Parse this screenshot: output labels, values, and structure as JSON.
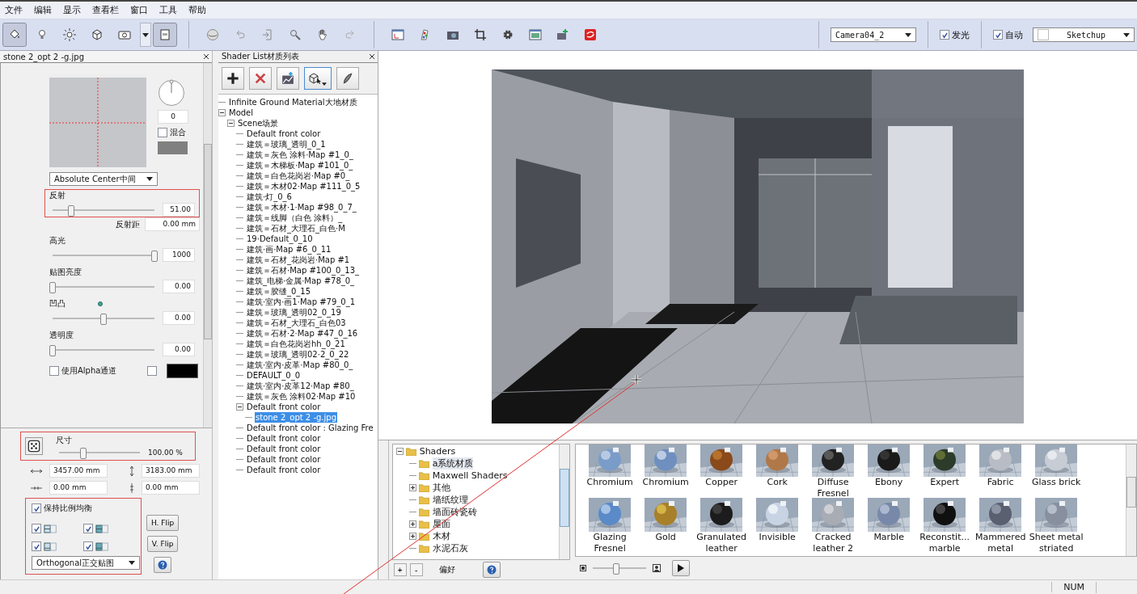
{
  "menu": [
    "文件",
    "编辑",
    "显示",
    "查看栏",
    "窗口",
    "工具",
    "帮助"
  ],
  "toolbar": {
    "mode_tools": [
      {
        "selected": true
      },
      {
        "selected": false
      },
      {
        "selected": false
      },
      {
        "selected": false
      },
      {
        "selected": false
      },
      {
        "selected": true
      }
    ],
    "camera": "Camera04_2",
    "glow": {
      "label": "发光",
      "checked": true
    },
    "auto": {
      "label": "自动",
      "checked": true
    },
    "renderer": "Sketchup"
  },
  "texture_panel": {
    "title": "stone 2_opt 2 -g.jpg",
    "rotation": "0",
    "blend": {
      "label": "混合",
      "checked": false
    },
    "projection": "Absolute Center中间",
    "sliders": [
      {
        "label": "反射",
        "level": 0.18,
        "value": "51.00",
        "highlighted": true
      },
      {
        "label": "高光",
        "level": 1.0,
        "value": "1000",
        "highlighted": false
      },
      {
        "label": "贴图亮度",
        "level": 0.0,
        "value": "0.00",
        "highlighted": false
      },
      {
        "label": "凹凸",
        "level": 0.5,
        "value": "0.00",
        "highlighted": false
      },
      {
        "label": "透明度",
        "level": 0.0,
        "value": "0.00",
        "highlighted": false
      }
    ],
    "reflect_distance": {
      "label": "反射距",
      "value": "0.00 mm"
    },
    "alpha": {
      "label": "使用Alpha通道",
      "checked": false,
      "invert_checked": false
    },
    "size": {
      "label": "尺寸",
      "level": 0.3,
      "value": "100.00 %",
      "highlighted": true
    },
    "width": "3457.00 mm",
    "height": "3183.00 mm",
    "offset_x": "0.00 mm",
    "offset_y": "0.00 mm",
    "keep_ratio": {
      "label": "保持比例均衡",
      "checked": true
    },
    "options_highlighted": true,
    "tiling": [
      {
        "checked": true
      },
      {
        "checked": true
      },
      {
        "checked": true
      },
      {
        "checked": true
      }
    ],
    "h_flip": "H. Flip",
    "v_flip": "V. Flip",
    "mapping": "Orthogonal正交贴图"
  },
  "shader_list": {
    "title": "Shader List材质列表",
    "tree": [
      {
        "label": "Infinite Ground Material大地材质",
        "selected": false
      },
      {
        "label": "Model",
        "expanded": true,
        "selected": false,
        "children": [
          {
            "label": "Scene场景",
            "expanded": true,
            "selected": false,
            "children": [
              {
                "label": "Default front color",
                "selected": false
              },
              {
                "label": "建筑＝玻璃_透明_0_1",
                "selected": false
              },
              {
                "label": "建筑＝灰色 涂料·Map #1_0_",
                "selected": false
              },
              {
                "label": "建筑＝木梯板·Map #101_0_",
                "selected": false
              },
              {
                "label": "建筑＝白色花岗岩·Map #0_",
                "selected": false
              },
              {
                "label": "建筑＝木材02·Map #111_0_5",
                "selected": false
              },
              {
                "label": "建筑·灯_0_6",
                "selected": false
              },
              {
                "label": "建筑＝木材·1·Map #98_0_7_",
                "selected": false
              },
              {
                "label": "建筑＝线脚（白色 涂料）_",
                "selected": false
              },
              {
                "label": "建筑＝石材_大理石_白色·M",
                "selected": false
              },
              {
                "label": "19·Default_0_10",
                "selected": false
              },
              {
                "label": "建筑·画·Map #6_0_11",
                "selected": false
              },
              {
                "label": "建筑＝石材_花岗岩·Map #1",
                "selected": false
              },
              {
                "label": "建筑＝石材·Map #100_0_13_",
                "selected": false
              },
              {
                "label": "建筑_电梯·金属·Map #78_0_",
                "selected": false
              },
              {
                "label": "建筑＝胶缝_0_15",
                "selected": false
              },
              {
                "label": "建筑·室内·画1·Map #79_0_1",
                "selected": false
              },
              {
                "label": "建筑＝玻璃_透明02_0_19",
                "selected": false
              },
              {
                "label": "建筑＝石材_大理石_白色03",
                "selected": false
              },
              {
                "label": "建筑＝石材·2·Map #47_0_16",
                "selected": false
              },
              {
                "label": "建筑＝白色花岗岩hh_0_21",
                "selected": false
              },
              {
                "label": "建筑＝玻璃_透明02·2_0_22",
                "selected": false
              },
              {
                "label": "建筑·室内·皮革·Map #80_0_",
                "selected": false
              },
              {
                "label": "DEFAULT_0_0",
                "selected": false
              },
              {
                "label": "建筑·室内·皮革12·Map #80_",
                "selected": false
              },
              {
                "label": "建筑＝灰色 涂料02·Map #10",
                "selected": false
              },
              {
                "label": "Default front color",
                "expanded": true,
                "selected": false,
                "children": [
                  {
                    "label": "stone 2_opt 2 -g.jpg",
                    "selected": true
                  }
                ]
              },
              {
                "label": "Default front color : Glazing Fre",
                "selected": false
              },
              {
                "label": "Default front color",
                "selected": false
              },
              {
                "label": "Default front color",
                "selected": false
              },
              {
                "label": "Default front color",
                "selected": false
              },
              {
                "label": "Default front color",
                "selected": false
              }
            ]
          }
        ]
      }
    ]
  },
  "viewport": {
    "kind": "picture"
  },
  "catalog": {
    "tree": [
      {
        "label": "Shaders",
        "expanded": true,
        "selected": false,
        "children": [
          {
            "label": "a系统材质",
            "selected": true
          },
          {
            "label": "Maxwell Shaders",
            "selected": false
          },
          {
            "label": "其他",
            "expanded": false,
            "selected": false
          },
          {
            "label": "墙纸纹理",
            "selected": false
          },
          {
            "label": "墙面砖瓷砖",
            "selected": false
          },
          {
            "label": "屋面",
            "expanded": false,
            "selected": false
          },
          {
            "label": "木材",
            "expanded": false,
            "selected": false
          },
          {
            "label": "水泥石灰",
            "selected": false
          }
        ]
      }
    ],
    "add": "+",
    "remove": "-",
    "favorites": "偏好",
    "materials": [
      {
        "name": "Chromium"
      },
      {
        "name": "Chromium"
      },
      {
        "name": "Copper"
      },
      {
        "name": "Cork"
      },
      {
        "name": "Diffuse Fresnel"
      },
      {
        "name": "Ebony"
      },
      {
        "name": "Expert"
      },
      {
        "name": "Fabric"
      },
      {
        "name": "Glass brick"
      },
      {
        "name": "Glazing Fresnel"
      },
      {
        "name": "Gold"
      },
      {
        "name": "Granulated leather"
      },
      {
        "name": "Invisible"
      },
      {
        "name": "Cracked leather 2"
      },
      {
        "name": "Marble"
      },
      {
        "name": "Reconstit... marble"
      },
      {
        "name": "Mammered metal"
      },
      {
        "name": "Sheet metal striated"
      }
    ],
    "thumb_size": {
      "level": 0.45
    }
  },
  "status_bar": {
    "num": "NUM"
  }
}
